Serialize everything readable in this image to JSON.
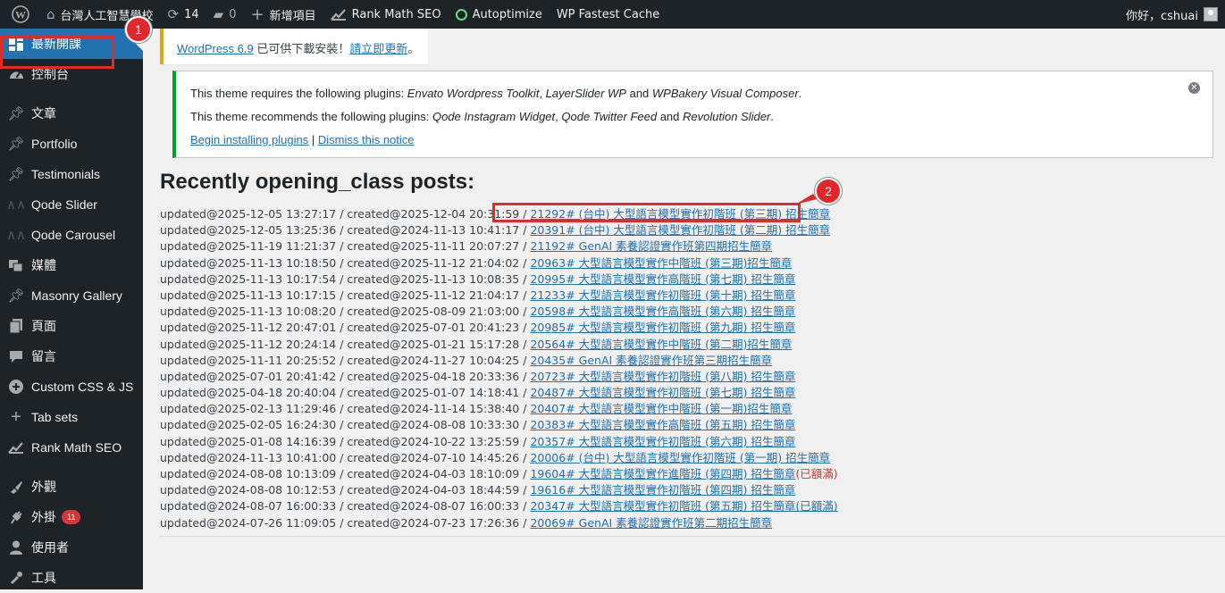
{
  "adminbar": {
    "site_name": "台灣人工智慧學校",
    "updates_count": "14",
    "comments_count": "0",
    "new_item": "新增項目",
    "rank_math": "Rank Math SEO",
    "autoptimize": "Autoptimize",
    "fastest_cache": "WP Fastest Cache",
    "greeting": "你好，cshuai"
  },
  "sidebar": {
    "items": [
      {
        "label": "最新開課",
        "icon": "dashboard-icon"
      },
      {
        "label": "控制台",
        "icon": "gauge-icon"
      },
      {
        "label": "文章",
        "icon": "pin-icon"
      },
      {
        "label": "Portfolio",
        "icon": "pin-icon"
      },
      {
        "label": "Testimonials",
        "icon": "pin-icon"
      },
      {
        "label": "Qode Slider",
        "icon": "slider-icon"
      },
      {
        "label": "Qode Carousel",
        "icon": "slider-icon"
      },
      {
        "label": "媒體",
        "icon": "media-icon"
      },
      {
        "label": "Masonry Gallery",
        "icon": "pin-icon"
      },
      {
        "label": "頁面",
        "icon": "page-icon"
      },
      {
        "label": "留言",
        "icon": "comment-icon"
      },
      {
        "label": "Custom CSS & JS",
        "icon": "plus-circle-icon"
      },
      {
        "label": "Tab sets",
        "icon": "plus-icon"
      },
      {
        "label": "Rank Math SEO",
        "icon": "rankmath-icon"
      },
      {
        "label": "外觀",
        "icon": "brush-icon"
      },
      {
        "label": "外掛",
        "icon": "plugin-icon",
        "badge": "11"
      },
      {
        "label": "使用者",
        "icon": "user-icon"
      },
      {
        "label": "工具",
        "icon": "tool-icon"
      }
    ]
  },
  "callouts": {
    "one": "1",
    "two": "2"
  },
  "update_nag": {
    "link": "WordPress 6.9",
    "text": " 已可供下載安裝！",
    "action": "請立即更新",
    "end": "。"
  },
  "notice": {
    "req_prefix": "This theme requires the following plugins: ",
    "req_p1": "Envato Wordpress Toolkit",
    "req_sep1": ", ",
    "req_p2": "LayerSlider WP",
    "req_and": " and ",
    "req_p3": "WPBakery Visual Composer",
    "req_end": ".",
    "rec_prefix": "This theme recommends the following plugins: ",
    "rec_p1": "Qode Instagram Widget",
    "rec_sep1": ", ",
    "rec_p2": "Qode Twitter Feed",
    "rec_and": " and ",
    "rec_p3": "Revolution Slider",
    "rec_end": ".",
    "begin": "Begin installing plugins",
    "pipe": " | ",
    "dismiss": "Dismiss this notice"
  },
  "posts_title": "Recently opening_class posts:",
  "posts": [
    {
      "meta": "updated@2025-12-05 13:27:17 / created@2025-12-04 20:31:59 / ",
      "link": "21292# (台中) 大型語言模型實作初階班 (第三期) 招生簡章",
      "suffix": ""
    },
    {
      "meta": "updated@2025-12-05 13:25:36 / created@2024-11-13 10:41:17 / ",
      "link": "20391# (台中) 大型語言模型實作初階班 (第二期) 招生簡章",
      "suffix": ""
    },
    {
      "meta": "updated@2025-11-19 11:21:37 / created@2025-11-11 20:07:27 / ",
      "link": "21192# GenAI 素養認證實作班第四期招生簡章",
      "suffix": ""
    },
    {
      "meta": "updated@2025-11-13 10:18:50 / created@2025-11-12 21:04:02 / ",
      "link": "20963# 大型語言模型實作中階班 (第三期)招生簡章",
      "suffix": ""
    },
    {
      "meta": "updated@2025-11-13 10:17:54 / created@2025-11-13 10:08:35 / ",
      "link": "20995# 大型語言模型實作高階班 (第七期) 招生簡章",
      "suffix": ""
    },
    {
      "meta": "updated@2025-11-13 10:17:15 / created@2025-11-12 21:04:17 / ",
      "link": "21233# 大型語言模型實作初階班 (第十期) 招生簡章",
      "suffix": ""
    },
    {
      "meta": "updated@2025-11-13 10:08:20 / created@2025-08-09 21:03:00 / ",
      "link": "20598# 大型語言模型實作高階班 (第六期) 招生簡章",
      "suffix": ""
    },
    {
      "meta": "updated@2025-11-12 20:47:01 / created@2025-07-01 20:41:23 / ",
      "link": "20985# 大型語言模型實作初階班 (第九期) 招生簡章",
      "suffix": ""
    },
    {
      "meta": "updated@2025-11-12 20:24:14 / created@2025-01-21 15:17:28 / ",
      "link": "20564# 大型語言模型實作中階班 (第二期)招生簡章",
      "suffix": ""
    },
    {
      "meta": "updated@2025-11-11 20:25:52 / created@2024-11-27 10:04:25 / ",
      "link": "20435# GenAI 素養認證實作班第三期招生簡章",
      "suffix": ""
    },
    {
      "meta": "updated@2025-07-01 20:41:42 / created@2025-04-18 20:33:36 / ",
      "link": "20723# 大型語言模型實作初階班 (第八期) 招生簡章",
      "suffix": ""
    },
    {
      "meta": "updated@2025-04-18 20:40:04 / created@2025-01-07 14:18:41 / ",
      "link": "20487# 大型語言模型實作初階班 (第七期) 招生簡章",
      "suffix": ""
    },
    {
      "meta": "updated@2025-02-13 11:29:46 / created@2024-11-14 15:38:40 / ",
      "link": "20407# 大型語言模型實作中階班 (第一期)招生簡章",
      "suffix": ""
    },
    {
      "meta": "updated@2025-02-05 16:24:30 / created@2024-08-08 10:33:30 / ",
      "link": "20383# 大型語言模型實作高階班 (第五期) 招生簡章",
      "suffix": ""
    },
    {
      "meta": "updated@2025-01-08 14:16:39 / created@2024-10-22 13:25:59 / ",
      "link": "20357# 大型語言模型實作初階班 (第六期) 招生簡章",
      "suffix": ""
    },
    {
      "meta": "updated@2024-11-13 10:41:00 / created@2024-07-10 14:45:26 / ",
      "link": "20006# (台中) 大型語言模型實作初階班 (第一期) 招生簡章",
      "suffix": ""
    },
    {
      "meta": "updated@2024-08-08 10:13:09 / created@2024-04-03 18:10:09 / ",
      "link": "19604# 大型語言模型實作進階班 (第四期) 招生簡章",
      "suffix": "(已額滿)"
    },
    {
      "meta": "updated@2024-08-08 10:12:53 / created@2024-04-03 18:44:59 / ",
      "link": "19616# 大型語言模型實作初階班 (第四期) 招生簡章",
      "suffix": ""
    },
    {
      "meta": "updated@2024-08-07 16:00:33 / created@2024-08-07 16:00:33 / ",
      "link": "20347# 大型語言模型實作初階班 (第五期) 招生簡章(已額滿)",
      "suffix": ""
    },
    {
      "meta": "updated@2024-07-26 11:09:05 / created@2024-07-23 17:26:36 / ",
      "link": "20069# GenAI 素養認證實作班第二期招生簡章",
      "suffix": ""
    }
  ]
}
